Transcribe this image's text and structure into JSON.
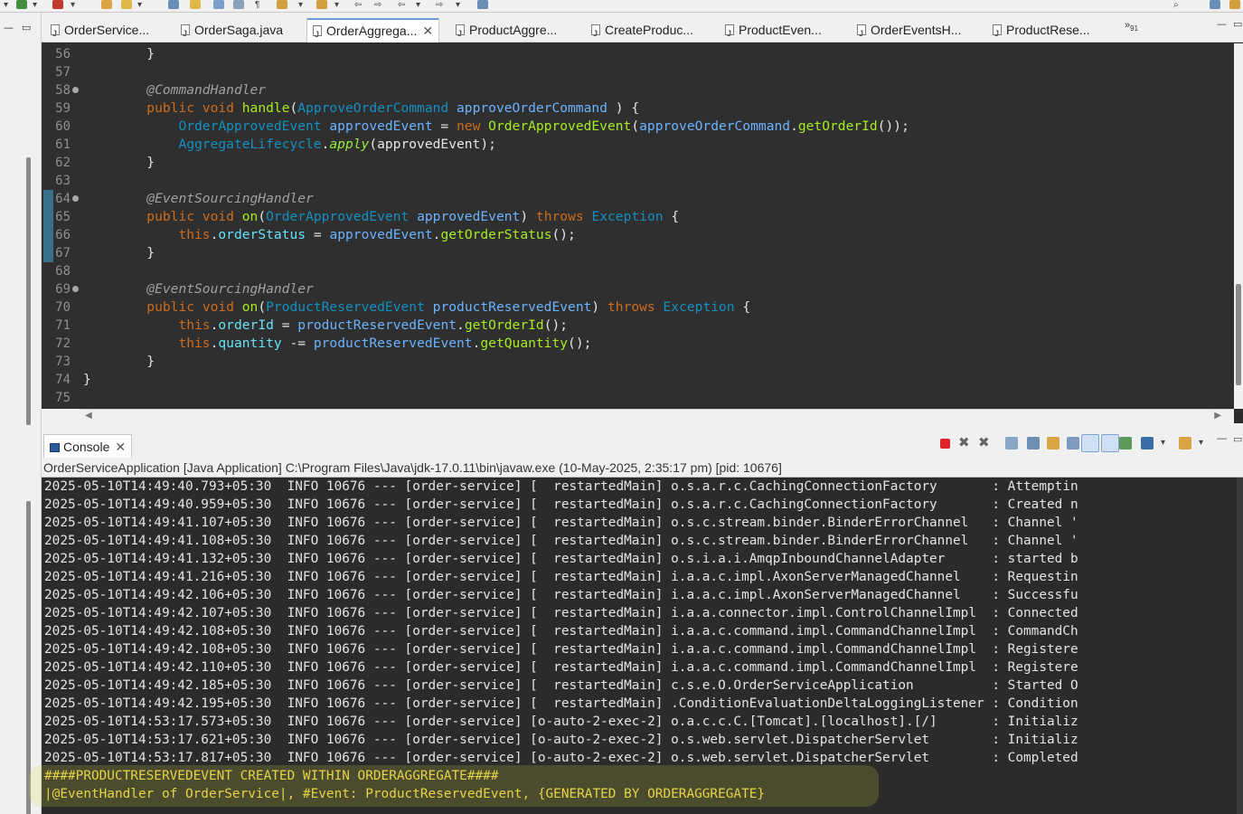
{
  "toolbar": {
    "icons": [
      "new-icon",
      "run-icon",
      "debug-icon",
      "open-icon",
      "search-icon",
      "perspective-icon"
    ]
  },
  "tabs": [
    {
      "label": "OrderService...",
      "active": false
    },
    {
      "label": "OrderSaga.java",
      "active": false
    },
    {
      "label": "OrderAggrega...",
      "active": true
    },
    {
      "label": "ProductAggre...",
      "active": false
    },
    {
      "label": "CreateProduc...",
      "active": false
    },
    {
      "label": "ProductEven...",
      "active": false
    },
    {
      "label": "OrderEventsH...",
      "active": false
    },
    {
      "label": "ProductRese...",
      "active": false
    }
  ],
  "tabs_overflow": {
    "label": "»",
    "count": "91"
  },
  "editor": {
    "line_numbers": [
      "56",
      "57",
      "58",
      "59",
      "60",
      "61",
      "62",
      "63",
      "64",
      "65",
      "66",
      "67",
      "68",
      "69",
      "70",
      "71",
      "72",
      "73",
      "74",
      "75"
    ]
  },
  "console": {
    "tab_label": "Console",
    "process_info": "OrderServiceApplication [Java Application] C:\\Program Files\\Java\\jdk-17.0.11\\bin\\javaw.exe  (10-May-2025, 2:35:17 pm) [pid: 10676]",
    "log_lines": [
      "2025-05-10T14:49:40.793+05:30  INFO 10676 --- [order-service] [  restartedMain] o.s.a.r.c.CachingConnectionFactory       : Attemptin",
      "2025-05-10T14:49:40.959+05:30  INFO 10676 --- [order-service] [  restartedMain] o.s.a.r.c.CachingConnectionFactory       : Created n",
      "2025-05-10T14:49:41.107+05:30  INFO 10676 --- [order-service] [  restartedMain] o.s.c.stream.binder.BinderErrorChannel   : Channel '",
      "2025-05-10T14:49:41.108+05:30  INFO 10676 --- [order-service] [  restartedMain] o.s.c.stream.binder.BinderErrorChannel   : Channel '",
      "2025-05-10T14:49:41.132+05:30  INFO 10676 --- [order-service] [  restartedMain] o.s.i.a.i.AmqpInboundChannelAdapter      : started b",
      "2025-05-10T14:49:41.216+05:30  INFO 10676 --- [order-service] [  restartedMain] i.a.a.c.impl.AxonServerManagedChannel    : Requestin",
      "2025-05-10T14:49:42.106+05:30  INFO 10676 --- [order-service] [  restartedMain] i.a.a.c.impl.AxonServerManagedChannel    : Successfu",
      "2025-05-10T14:49:42.107+05:30  INFO 10676 --- [order-service] [  restartedMain] i.a.a.connector.impl.ControlChannelImpl  : Connected",
      "2025-05-10T14:49:42.108+05:30  INFO 10676 --- [order-service] [  restartedMain] i.a.a.c.command.impl.CommandChannelImpl  : CommandCh",
      "2025-05-10T14:49:42.108+05:30  INFO 10676 --- [order-service] [  restartedMain] i.a.a.c.command.impl.CommandChannelImpl  : Registere",
      "2025-05-10T14:49:42.110+05:30  INFO 10676 --- [order-service] [  restartedMain] i.a.a.c.command.impl.CommandChannelImpl  : Registere",
      "2025-05-10T14:49:42.185+05:30  INFO 10676 --- [order-service] [  restartedMain] c.s.e.O.OrderServiceApplication          : Started O",
      "2025-05-10T14:49:42.195+05:30  INFO 10676 --- [order-service] [  restartedMain] .ConditionEvaluationDeltaLoggingListener : Condition",
      "2025-05-10T14:53:17.573+05:30  INFO 10676 --- [order-service] [o-auto-2-exec-2] o.a.c.c.C.[Tomcat].[localhost].[/]       : Initializ",
      "2025-05-10T14:53:17.621+05:30  INFO 10676 --- [order-service] [o-auto-2-exec-2] o.s.web.servlet.DispatcherServlet        : Initializ",
      "2025-05-10T14:53:17.817+05:30  INFO 10676 --- [order-service] [o-auto-2-exec-2] o.s.web.servlet.DispatcherServlet        : Completed"
    ],
    "custom_lines": [
      "####PRODUCTRESERVEDEVENT CREATED WITHIN ORDERAGGREGATE####",
      "|@EventHandler of OrderService|, #Event: ProductReservedEvent, {GENERATED BY ORDERAGGREGATE}"
    ]
  },
  "colors": {
    "editor_bg": "#2f2f2f",
    "keyword": "#cc6c1d",
    "type": "#1290c3",
    "variable": "#6bb3ff",
    "method": "#a7ec21",
    "field": "#66e1f8",
    "annotation": "#a0a0a0",
    "custom_log": "#e8d24a"
  }
}
